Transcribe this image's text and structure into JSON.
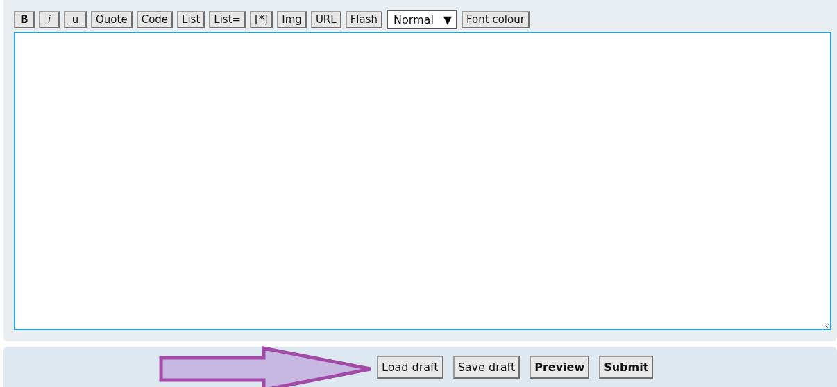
{
  "toolbar": [
    {
      "label": "B",
      "kind": "bold"
    },
    {
      "label": "i",
      "kind": "italic"
    },
    {
      "label": " u ",
      "kind": "underline"
    },
    {
      "label": "Quote",
      "kind": "plain"
    },
    {
      "label": "Code",
      "kind": "plain"
    },
    {
      "label": "List",
      "kind": "plain"
    },
    {
      "label": "List=",
      "kind": "plain"
    },
    {
      "label": "[*]",
      "kind": "plain"
    },
    {
      "label": "Img",
      "kind": "plain"
    },
    {
      "label": "URL",
      "kind": "underline"
    },
    {
      "label": "Flash",
      "kind": "plain"
    },
    {
      "label": "Normal",
      "kind": "select",
      "caret": "▼"
    },
    {
      "label": "Font colour",
      "kind": "plain"
    }
  ],
  "actions": [
    {
      "label": "Load draft",
      "bold": false
    },
    {
      "label": "Save draft",
      "bold": false
    },
    {
      "label": "Preview",
      "bold": true
    },
    {
      "label": "Submit",
      "bold": true
    }
  ]
}
